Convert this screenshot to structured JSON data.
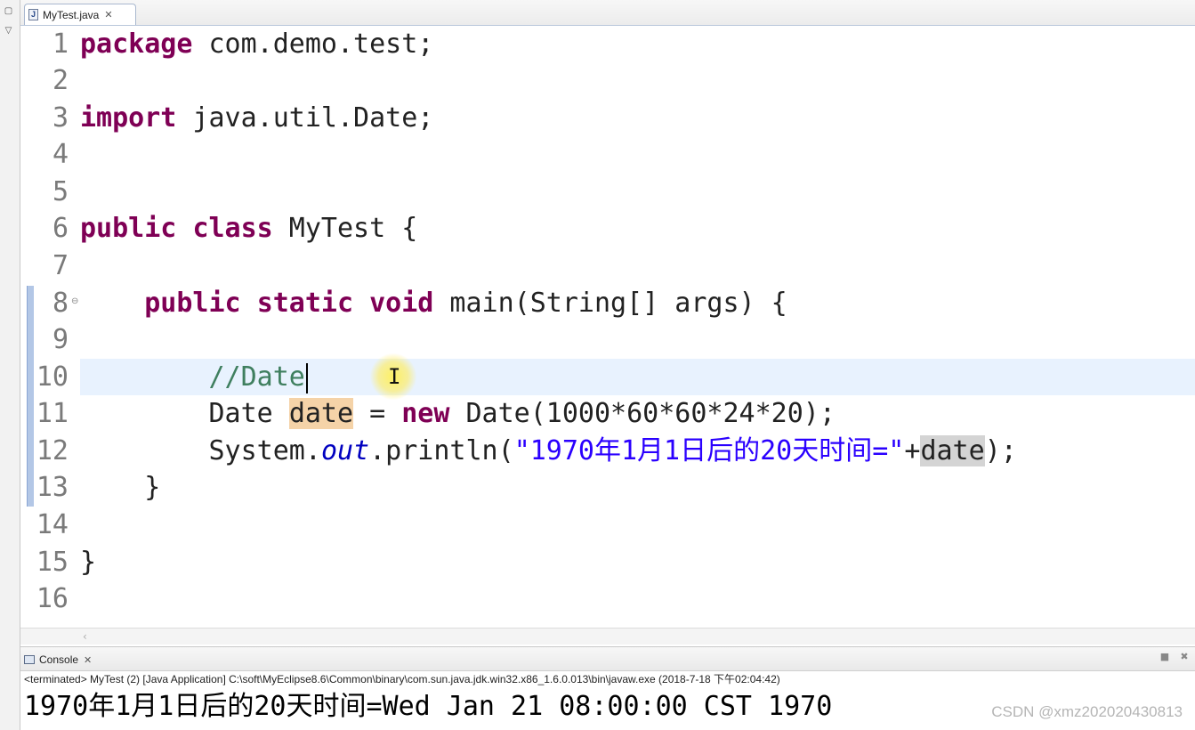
{
  "editor": {
    "tab_label": "MyTest.java",
    "file_icon_glyph": "J",
    "close_glyph": "✕",
    "line_numbers": [
      "1",
      "2",
      "3",
      "4",
      "5",
      "6",
      "7",
      "8",
      "9",
      "10",
      "11",
      "12",
      "13",
      "14",
      "15",
      "16"
    ],
    "current_line": 10,
    "lines": {
      "l1_kw": "package",
      "l1_rest": " com.demo.test;",
      "l3_kw": "import",
      "l3_rest": " java.util.Date;",
      "l6_kw1": "public",
      "l6_kw2": "class",
      "l6_rest": " MyTest {",
      "l8_indent": "    ",
      "l8_kw1": "public",
      "l8_kw2": "static",
      "l8_kw3": "void",
      "l8_rest": " main(String[] args) {",
      "l10_indent": "        ",
      "l10_comment": "//Date",
      "l11_a": "        Date ",
      "l11_var": "date",
      "l11_b": " = ",
      "l11_kw": "new",
      "l11_c": " Date(1000*60*60*24*20);",
      "l12_a": "        System.",
      "l12_field": "out",
      "l12_b": ".println(",
      "l12_str": "\"1970年1月1日后的20天时间=\"",
      "l12_c": "+",
      "l12_var": "date",
      "l12_d": ");",
      "l13": "    }",
      "l15": "}"
    }
  },
  "console": {
    "tab_label": "Console",
    "status": "<terminated> MyTest (2) [Java Application] C:\\soft\\MyEclipse8.6\\Common\\binary\\com.sun.java.jdk.win32.x86_1.6.0.013\\bin\\javaw.exe (2018-7-18 下午02:04:42)",
    "output": "1970年1月1日后的20天时间=Wed Jan 21 08:00:00 CST 1970"
  },
  "watermark": "CSDN @xmz202020430813",
  "icons": {
    "minimize": "minimize-icon",
    "terminate": "terminate-icon",
    "remove": "remove-launch-icon"
  },
  "colors": {
    "keyword": "#7f0055",
    "comment": "#3f7f5f",
    "string": "#2a00ff",
    "field": "#0000c0",
    "occurrence_highlight": "#f5d3a8",
    "current_line": "#e8f2fe"
  }
}
